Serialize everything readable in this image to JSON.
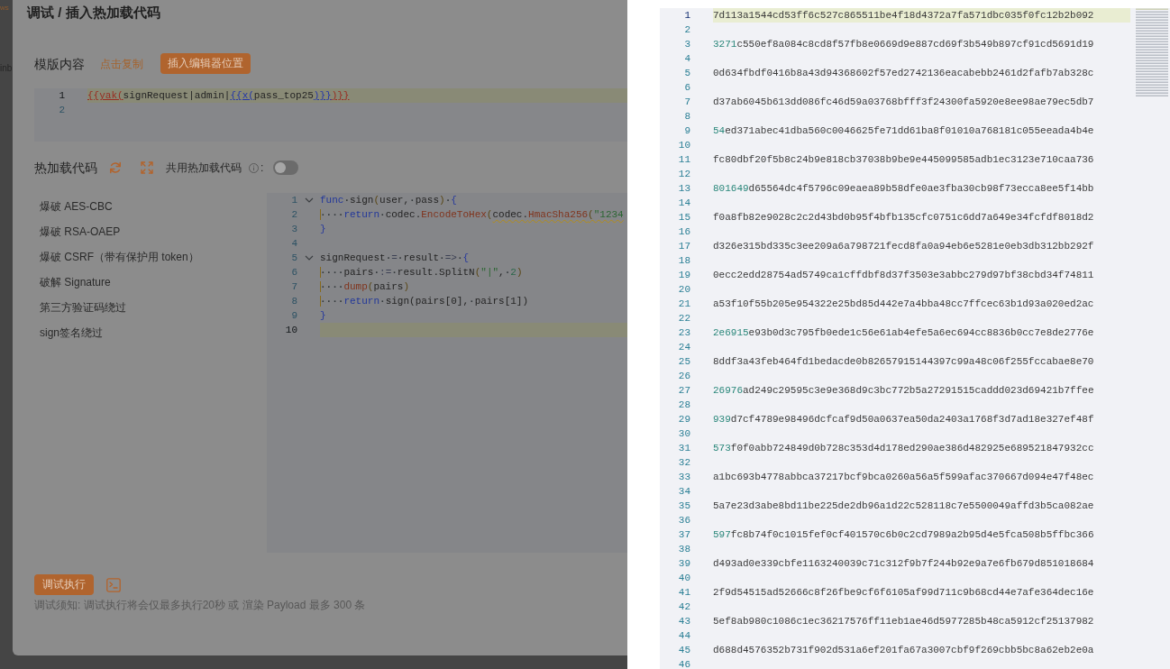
{
  "sidebar_fragments": [
    {
      "text": "ws",
      "kind": "accent"
    },
    {
      "text": "inb",
      "kind": "plain"
    }
  ],
  "dialog": {
    "title": "调试 / 插入热加载代码",
    "template": {
      "label": "模版内容",
      "copy_link": "点击复制",
      "insert_button": "插入编辑器位置",
      "editor": {
        "lines": [
          {
            "number": "1",
            "current": true,
            "tokens": [
              {
                "kind": "outer",
                "text": "{{yak("
              },
              {
                "kind": "plain",
                "text": "signRequest|admin|"
              },
              {
                "kind": "inner",
                "text": "{{x("
              },
              {
                "kind": "plain",
                "text": "pass_top25"
              },
              {
                "kind": "inner",
                "text": ")}}"
              },
              {
                "kind": "outer",
                "text": ")}}"
              }
            ]
          },
          {
            "number": "2",
            "current": false
          }
        ]
      }
    },
    "hotload": {
      "label": "热加载代码",
      "shared_label": "共用热加载代码",
      "shared_suffix": ":",
      "shared_toggle": {
        "on": false
      },
      "templates": [
        {
          "label": "爆破 AES-CBC",
          "selected": false
        },
        {
          "label": "爆破 RSA-OAEP",
          "selected": false
        },
        {
          "label": "爆破 CSRF（带有保护用 token）",
          "selected": false
        },
        {
          "label": "破解 Signature",
          "selected": false
        },
        {
          "label": "第三方验证码绕过",
          "selected": false
        },
        {
          "label": "sign签名绕过",
          "selected": false
        }
      ],
      "editor": {
        "lines": [
          {
            "number": "1",
            "current": false,
            "expanded": true,
            "tokens": [
              {
                "kind": "kw",
                "text": "func"
              },
              {
                "kind": "ws",
                "text": "·"
              },
              {
                "kind": "fn",
                "text": "sign"
              },
              {
                "kind": "paren",
                "text": "("
              },
              {
                "kind": "ident",
                "text": "user"
              },
              {
                "kind": "punct",
                "text": ","
              },
              {
                "kind": "ws",
                "text": "·"
              },
              {
                "kind": "ident",
                "text": "pass"
              },
              {
                "kind": "paren",
                "text": ")"
              },
              {
                "kind": "ws",
                "text": "·"
              },
              {
                "kind": "brace",
                "text": "{"
              }
            ]
          },
          {
            "number": "2",
            "current": false,
            "tokens": [
              {
                "kind": "indent",
                "text": "····"
              },
              {
                "kind": "kw",
                "text": "return"
              },
              {
                "kind": "ws",
                "text": "·"
              },
              {
                "kind": "ident",
                "text": "codec."
              },
              {
                "kind": "method",
                "text": "EncodeToHex"
              },
              {
                "kind": "paren",
                "text": "("
              },
              {
                "kind": "warning",
                "tokens": [
                  {
                    "kind": "ident",
                    "text": "codec."
                  },
                  {
                    "kind": "method",
                    "text": "HmacSha256"
                  },
                  {
                    "kind": "paren",
                    "text": "("
                  },
                  {
                    "kind": "str",
                    "text": "\"1234"
                  }
                ]
              }
            ]
          },
          {
            "number": "3",
            "current": false,
            "tokens": [
              {
                "kind": "brace",
                "text": "}"
              }
            ]
          },
          {
            "number": "4",
            "current": false
          },
          {
            "number": "5",
            "current": false,
            "expanded": true,
            "tokens": [
              {
                "kind": "ident",
                "text": "signRequest"
              },
              {
                "kind": "ws",
                "text": "·"
              },
              {
                "kind": "op",
                "text": "="
              },
              {
                "kind": "ws",
                "text": "·"
              },
              {
                "kind": "ident",
                "text": "result"
              },
              {
                "kind": "ws",
                "text": "·"
              },
              {
                "kind": "op",
                "text": "=>"
              },
              {
                "kind": "ws",
                "text": "·"
              },
              {
                "kind": "brace",
                "text": "{"
              }
            ]
          },
          {
            "number": "6",
            "current": false,
            "tokens": [
              {
                "kind": "indent",
                "text": "····"
              },
              {
                "kind": "ident",
                "text": "pairs"
              },
              {
                "kind": "ws",
                "text": "·"
              },
              {
                "kind": "op",
                "text": ":="
              },
              {
                "kind": "ws",
                "text": "·"
              },
              {
                "kind": "ident",
                "text": "result.SplitN"
              },
              {
                "kind": "paren",
                "text": "("
              },
              {
                "kind": "str",
                "text": "\"|\""
              },
              {
                "kind": "punct",
                "text": ","
              },
              {
                "kind": "ws",
                "text": "·"
              },
              {
                "kind": "num",
                "text": "2"
              },
              {
                "kind": "paren",
                "text": ")"
              }
            ]
          },
          {
            "number": "7",
            "current": false,
            "tokens": [
              {
                "kind": "indent",
                "text": "····"
              },
              {
                "kind": "method",
                "text": "dump"
              },
              {
                "kind": "paren",
                "text": "("
              },
              {
                "kind": "ident",
                "text": "pairs"
              },
              {
                "kind": "paren",
                "text": ")"
              }
            ]
          },
          {
            "number": "8",
            "current": false,
            "tokens": [
              {
                "kind": "indent",
                "text": "····"
              },
              {
                "kind": "kw",
                "text": "return"
              },
              {
                "kind": "ws",
                "text": "·"
              },
              {
                "kind": "ident",
                "text": "sign(pairs[0],"
              },
              {
                "kind": "ws",
                "text": "·"
              },
              {
                "kind": "ident",
                "text": "pairs[1])"
              }
            ]
          },
          {
            "number": "9",
            "current": false,
            "tokens": [
              {
                "kind": "brace",
                "text": "}"
              }
            ]
          },
          {
            "number": "10",
            "current": true
          }
        ]
      }
    },
    "run_button": "调试执行",
    "notice": "调试须知: 调试执行将会仅最多执行20秒 或 渲染 Payload 最多 300 条"
  },
  "output": {
    "lines": [
      {
        "number": "1",
        "current": true,
        "tokens": [
          {
            "kind": "plain",
            "text": "7d113a1544cd53ff6c527c865511be4f18d4372a7fa571dbc035f0fc12b2b092"
          }
        ]
      },
      {
        "number": "2",
        "current": false
      },
      {
        "number": "3",
        "current": false,
        "tokens": [
          {
            "kind": "num",
            "text": "3271"
          },
          {
            "kind": "plain",
            "text": "c550ef8a084c8cd8f57fb8e0669d9e887cd69f3b549b897cf91cd5691d19"
          }
        ]
      },
      {
        "number": "4",
        "current": false
      },
      {
        "number": "5",
        "current": false,
        "tokens": [
          {
            "kind": "plain",
            "text": "0d634fbdf0416b8a43d94368602f57ed2742136eacabebb2461d2fafb7ab328c"
          }
        ]
      },
      {
        "number": "6",
        "current": false
      },
      {
        "number": "7",
        "current": false,
        "tokens": [
          {
            "kind": "plain",
            "text": "d37ab6045b613dd086fc46d59a03768bfff3f24300fa5920e8ee98ae79ec5db7"
          }
        ]
      },
      {
        "number": "8",
        "current": false
      },
      {
        "number": "9",
        "current": false,
        "tokens": [
          {
            "kind": "num",
            "text": "54"
          },
          {
            "kind": "plain",
            "text": "ed371abec41dba560c0046625fe71dd61ba8f01010a768181c055eeada4b4e"
          }
        ]
      },
      {
        "number": "10",
        "current": false
      },
      {
        "number": "11",
        "current": false,
        "tokens": [
          {
            "kind": "plain",
            "text": "fc80dbf20f5b8c24b9e818cb37038b9be9e445099585adb1ec3123e710caa736"
          }
        ]
      },
      {
        "number": "12",
        "current": false
      },
      {
        "number": "13",
        "current": false,
        "tokens": [
          {
            "kind": "num",
            "text": "801649"
          },
          {
            "kind": "plain",
            "text": "d65564dc4f5796c09eaea89b58dfe0ae3fba30cb98f73ecca8ee5f14bb"
          }
        ]
      },
      {
        "number": "14",
        "current": false
      },
      {
        "number": "15",
        "current": false,
        "tokens": [
          {
            "kind": "plain",
            "text": "f0a8fb82e9028c2c2d43bd0b95f4bfb135cfc0751c6dd7a649e34fcfdf8018d2"
          }
        ]
      },
      {
        "number": "16",
        "current": false
      },
      {
        "number": "17",
        "current": false,
        "tokens": [
          {
            "kind": "plain",
            "text": "d326e315bd335c3ee209a6a798721fecd8fa0a94eb6e5281e0eb3db312bb292f"
          }
        ]
      },
      {
        "number": "18",
        "current": false
      },
      {
        "number": "19",
        "current": false,
        "tokens": [
          {
            "kind": "plain",
            "text": "0ecc2edd28754ad5749ca1cffdbf8d37f3503e3abbc279d97bf38cbd34f74811"
          }
        ]
      },
      {
        "number": "20",
        "current": false
      },
      {
        "number": "21",
        "current": false,
        "tokens": [
          {
            "kind": "plain",
            "text": "a53f10f55b205e954322e25bd85d442e7a4bba48cc7ffcec63b1d93a020ed2ac"
          }
        ]
      },
      {
        "number": "22",
        "current": false
      },
      {
        "number": "23",
        "current": false,
        "tokens": [
          {
            "kind": "num",
            "text": "2e6915"
          },
          {
            "kind": "plain",
            "text": "e93b0d3c795fb0ede1c56e61ab4efe5a6ec694cc8836b0cc7e8de2776e"
          }
        ]
      },
      {
        "number": "24",
        "current": false
      },
      {
        "number": "25",
        "current": false,
        "tokens": [
          {
            "kind": "plain",
            "text": "8ddf3a43feb464fd1bedacde0b82657915144397c99a48c06f255fccabae8e70"
          }
        ]
      },
      {
        "number": "26",
        "current": false
      },
      {
        "number": "27",
        "current": false,
        "tokens": [
          {
            "kind": "num",
            "text": "26976"
          },
          {
            "kind": "plain",
            "text": "ad249c29595c3e9e368d9c3bc772b5a27291515caddd023d69421b7ffee"
          }
        ]
      },
      {
        "number": "28",
        "current": false
      },
      {
        "number": "29",
        "current": false,
        "tokens": [
          {
            "kind": "num",
            "text": "939"
          },
          {
            "kind": "plain",
            "text": "d7cf4789e98496dcfcaf9d50a0637ea50da2403a1768f3d7ad18e327ef48f"
          }
        ]
      },
      {
        "number": "30",
        "current": false
      },
      {
        "number": "31",
        "current": false,
        "tokens": [
          {
            "kind": "num",
            "text": "573"
          },
          {
            "kind": "plain",
            "text": "f0f0abb724849d0b728c353d4d178ed290ae386d482925e689521847932cc"
          }
        ]
      },
      {
        "number": "32",
        "current": false
      },
      {
        "number": "33",
        "current": false,
        "tokens": [
          {
            "kind": "plain",
            "text": "a1bc693b4778abbca37217bcf9bca0260a56a5f599afac370667d094e47f48ec"
          }
        ]
      },
      {
        "number": "34",
        "current": false
      },
      {
        "number": "35",
        "current": false,
        "tokens": [
          {
            "kind": "plain",
            "text": "5a7e23d3abe8bd11be225de2db96a1d22c528118c7e5500049affd3b5ca082ae"
          }
        ]
      },
      {
        "number": "36",
        "current": false
      },
      {
        "number": "37",
        "current": false,
        "tokens": [
          {
            "kind": "num",
            "text": "597"
          },
          {
            "kind": "plain",
            "text": "fc8b74f0c1015fef0cf401570c6b0c2cd7989a2b95d4e5fca508b5ffbc366"
          }
        ]
      },
      {
        "number": "38",
        "current": false
      },
      {
        "number": "39",
        "current": false,
        "tokens": [
          {
            "kind": "plain",
            "text": "d493ad0e339cbfe1163240039c71c312f9b7f244b92e9a7e6fb679d851018684"
          }
        ]
      },
      {
        "number": "40",
        "current": false
      },
      {
        "number": "41",
        "current": false,
        "tokens": [
          {
            "kind": "plain",
            "text": "2f9d54515ad52666c8f26fbe9cf6f6105af99d711c9b68cd44e7afe364dec16e"
          }
        ]
      },
      {
        "number": "42",
        "current": false
      },
      {
        "number": "43",
        "current": false,
        "tokens": [
          {
            "kind": "plain",
            "text": "5ef8ab980c1086c1ec36217576ff11eb1ae46d5977285b48ca5912cf25137982"
          }
        ]
      },
      {
        "number": "44",
        "current": false
      },
      {
        "number": "45",
        "current": false,
        "tokens": [
          {
            "kind": "plain",
            "text": "d688d4576352b731f902d531a6ef201fa67a3007cbf9f269cbb5bc8a62eb2e0a"
          }
        ]
      },
      {
        "number": "46",
        "current": false
      }
    ]
  }
}
